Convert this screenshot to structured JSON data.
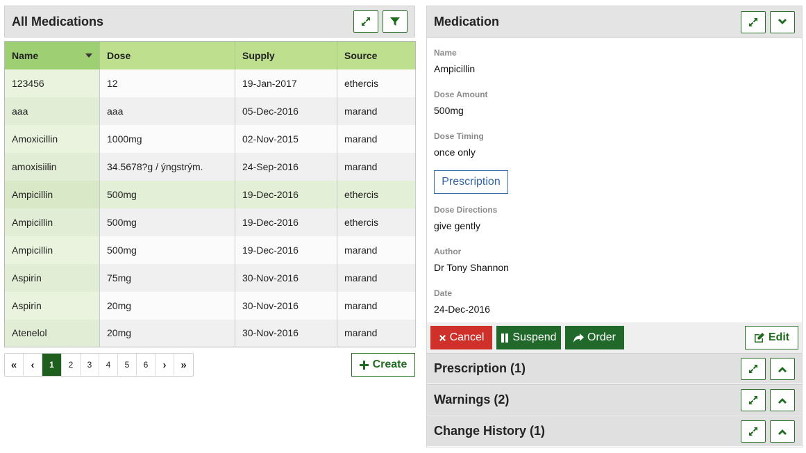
{
  "left_panel": {
    "title": "All Medications",
    "columns": [
      "Name",
      "Dose",
      "Supply",
      "Source"
    ],
    "rows": [
      {
        "name": "123456",
        "dose": "12",
        "supply": "19-Jan-2017",
        "source": "ethercis"
      },
      {
        "name": "aaa",
        "dose": "aaa",
        "supply": "05-Dec-2016",
        "source": "marand"
      },
      {
        "name": "Amoxicillin",
        "dose": "1000mg",
        "supply": "02-Nov-2015",
        "source": "marand"
      },
      {
        "name": "amoxisiilin",
        "dose": "34.5678?g / ýngstrým.",
        "supply": "24-Sep-2016",
        "source": "marand"
      },
      {
        "name": "Ampicillin",
        "dose": "500mg",
        "supply": "19-Dec-2016",
        "source": "ethercis"
      },
      {
        "name": "Ampicillin",
        "dose": "500mg",
        "supply": "19-Dec-2016",
        "source": "ethercis"
      },
      {
        "name": "Ampicillin",
        "dose": "500mg",
        "supply": "19-Dec-2016",
        "source": "marand"
      },
      {
        "name": "Aspirin",
        "dose": "75mg",
        "supply": "30-Nov-2016",
        "source": "marand"
      },
      {
        "name": "Aspirin",
        "dose": "20mg",
        "supply": "30-Nov-2016",
        "source": "marand"
      },
      {
        "name": "Atenelol",
        "dose": "20mg",
        "supply": "30-Nov-2016",
        "source": "marand"
      }
    ],
    "selected_row": 4,
    "pagination": {
      "first": "«",
      "prev": "‹",
      "pages": [
        "1",
        "2",
        "3",
        "4",
        "5",
        "6"
      ],
      "active_page": "1",
      "next": "›",
      "last": "»"
    },
    "create_label": "Create"
  },
  "right_panel": {
    "title": "Medication",
    "fields": {
      "name_label": "Name",
      "name_value": "Ampicillin",
      "dose_amount_label": "Dose Amount",
      "dose_amount_value": "500mg",
      "dose_timing_label": "Dose Timing",
      "dose_timing_value": "once only",
      "dose_directions_label": "Dose Directions",
      "dose_directions_value": "give gently",
      "author_label": "Author",
      "author_value": "Dr Tony Shannon",
      "date_label": "Date",
      "date_value": "24-Dec-2016"
    },
    "prescription_button": "Prescription",
    "actions": {
      "cancel": "Cancel",
      "suspend": "Suspend",
      "order": "Order",
      "edit": "Edit"
    },
    "sections": {
      "prescription": "Prescription (1)",
      "warnings": "Warnings (2)",
      "change_history": "Change History (1)"
    }
  },
  "colors": {
    "header_green": "#bddf8e",
    "dark_green": "#21692a",
    "cancel_red": "#d0302a",
    "link_blue": "#3166a8"
  },
  "icons": [
    "expand-icon",
    "filter-icon",
    "chevron-down-icon",
    "chevron-up-icon",
    "plus-icon",
    "times-icon",
    "pause-icon",
    "share-icon",
    "edit-icon"
  ]
}
